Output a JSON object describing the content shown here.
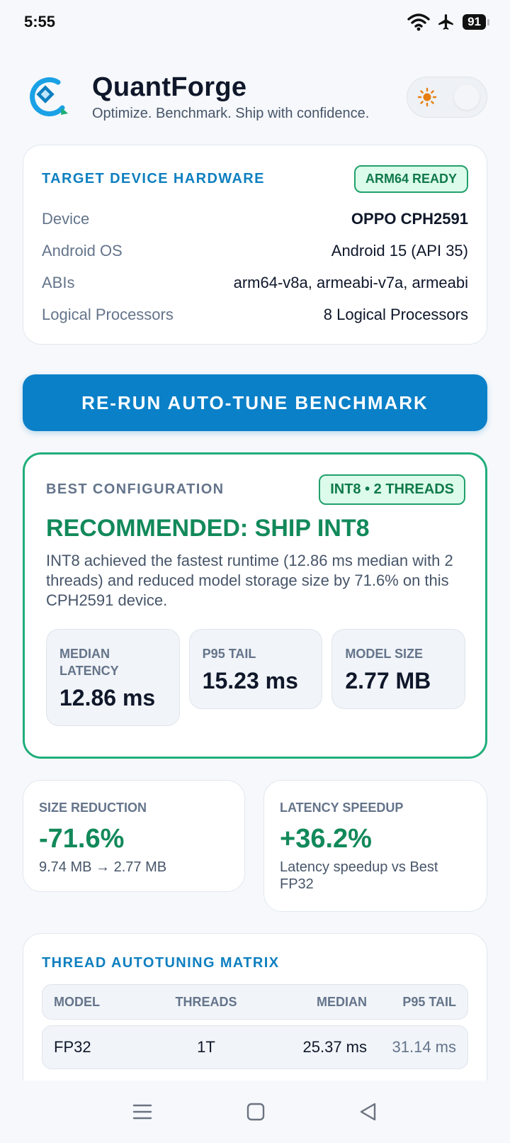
{
  "status": {
    "time": "5:55",
    "battery": "91"
  },
  "header": {
    "title": "QuantForge",
    "tagline": "Optimize. Benchmark. Ship with confidence."
  },
  "hardware": {
    "title": "TARGET DEVICE HARDWARE",
    "badge": "ARM64 READY",
    "rows": [
      {
        "key": "Device",
        "value": "OPPO CPH2591"
      },
      {
        "key": "Android OS",
        "value": "Android 15 (API 35)"
      },
      {
        "key": "ABIs",
        "value": "arm64-v8a, armeabi-v7a, armeabi"
      },
      {
        "key": "Logical Processors",
        "value": "8 Logical Processors"
      }
    ]
  },
  "run_button": "RE-RUN AUTO-TUNE BENCHMARK",
  "best": {
    "label": "BEST CONFIGURATION",
    "badge": "INT8 • 2 THREADS",
    "headline": "RECOMMENDED: SHIP INT8",
    "description": "INT8 achieved the fastest runtime (12.86 ms median with 2 threads) and reduced model storage size by 71.6% on this CPH2591 device.",
    "metrics": [
      {
        "label": "MEDIAN LATENCY",
        "value": "12.86 ms"
      },
      {
        "label": "P95 TAIL",
        "value": "15.23 ms"
      },
      {
        "label": "MODEL SIZE",
        "value": "2.77 MB"
      }
    ]
  },
  "stats": {
    "size": {
      "label": "SIZE REDUCTION",
      "value": "-71.6%",
      "sub": "9.74 MB → 2.77 MB"
    },
    "latency": {
      "label": "LATENCY SPEEDUP",
      "value": "+36.2%",
      "sub": "Latency speedup vs Best FP32"
    }
  },
  "matrix": {
    "title": "THREAD AUTOTUNING MATRIX",
    "columns": [
      "MODEL",
      "THREADS",
      "MEDIAN",
      "P95 TAIL"
    ],
    "rows": [
      [
        "FP32",
        "1T",
        "25.37 ms",
        "31.14 ms"
      ]
    ]
  },
  "colors": {
    "accent": "#0a80c8",
    "success": "#12895a",
    "success_border": "#1fae7a"
  },
  "icons": [
    "wifi-icon",
    "airplane-icon",
    "battery-icon",
    "app-logo-icon",
    "sun-icon",
    "menu-icon",
    "home-icon",
    "back-icon"
  ]
}
